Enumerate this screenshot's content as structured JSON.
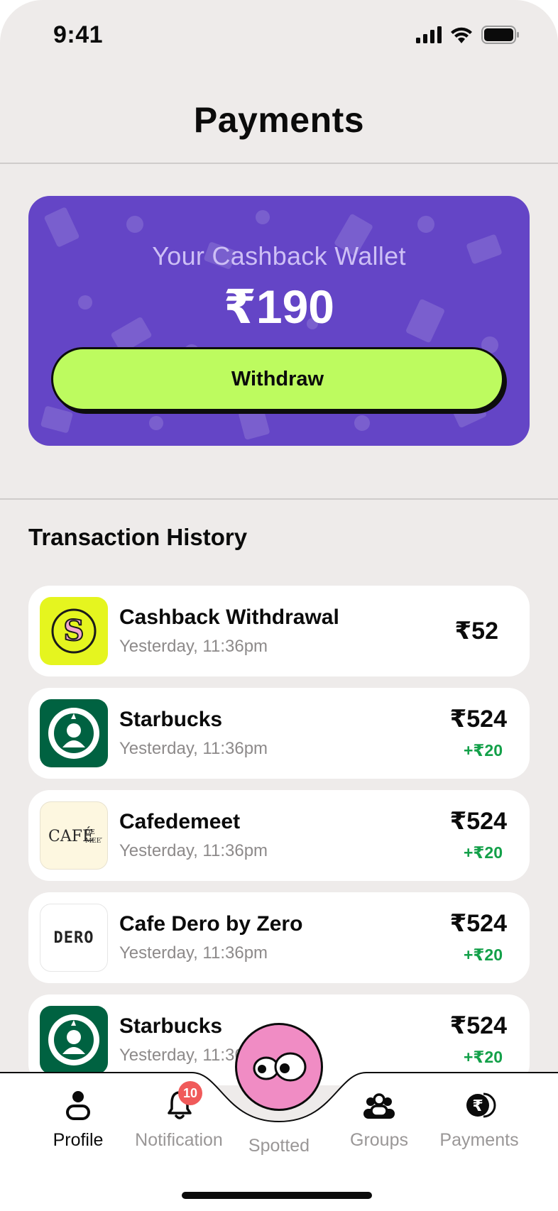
{
  "status_bar": {
    "time": "9:41"
  },
  "header": {
    "title": "Payments"
  },
  "wallet": {
    "label": "Your Cashback Wallet",
    "amount": "₹190",
    "button_label": "Withdraw",
    "card_color": "#6445c6",
    "button_color": "#bdfb5f"
  },
  "transactions": {
    "title": "Transaction History",
    "items": [
      {
        "name": "Cashback Withdrawal",
        "time": "Yesterday, 11:36pm",
        "amount": "₹52",
        "cashback": "",
        "logo": "spotted-s-logo"
      },
      {
        "name": "Starbucks",
        "time": "Yesterday, 11:36pm",
        "amount": "₹524",
        "cashback": "+₹20",
        "logo": "starbucks-logo"
      },
      {
        "name": "Cafedemeet",
        "time": "Yesterday, 11:36pm",
        "amount": "₹524",
        "cashback": "+₹20",
        "logo": "cafedemeet-logo"
      },
      {
        "name": "Cafe Dero by Zero",
        "time": "Yesterday, 11:36pm",
        "amount": "₹524",
        "cashback": "+₹20",
        "logo": "dero-logo",
        "logo_text": "DERO"
      },
      {
        "name": "Starbucks",
        "time": "Yesterday, 11:36pm",
        "amount": "₹524",
        "cashback": "+₹20",
        "logo": "starbucks-logo"
      }
    ]
  },
  "nav": {
    "items": [
      {
        "label": "Profile",
        "icon": "profile-icon",
        "active": true
      },
      {
        "label": "Notification",
        "icon": "bell-icon",
        "badge": "10"
      },
      {
        "label": "Spotted",
        "icon": "spotted-eyes-icon"
      },
      {
        "label": "Groups",
        "icon": "groups-icon"
      },
      {
        "label": "Payments",
        "icon": "rupee-coin-icon"
      }
    ]
  },
  "colors": {
    "cashback_green": "#13a049",
    "spotted_pink": "#f08cc4",
    "badge_red": "#f05a5a"
  }
}
